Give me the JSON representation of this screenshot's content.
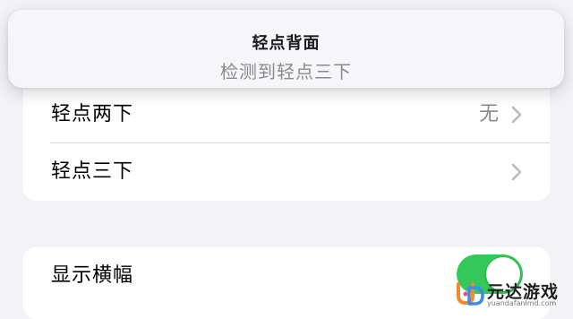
{
  "hud": {
    "title": "轻点背面",
    "subtitle": "检测到轻点三下"
  },
  "tap_settings": {
    "rows": [
      {
        "label": "轻点两下",
        "value": "无"
      },
      {
        "label": "轻点三下",
        "value": ""
      }
    ]
  },
  "banner_settings": {
    "label": "显示横幅",
    "toggle_on": true
  },
  "watermark": {
    "brand": "元达游戏",
    "url": "yuandafanlmd.com"
  },
  "colors": {
    "background": "#f2f2f7",
    "toggle_on": "#34c759",
    "secondary_text": "#8a8a8e"
  },
  "icons": [
    "chevron-right-icon",
    "toggle-switch",
    "ud-logo-icon"
  ]
}
